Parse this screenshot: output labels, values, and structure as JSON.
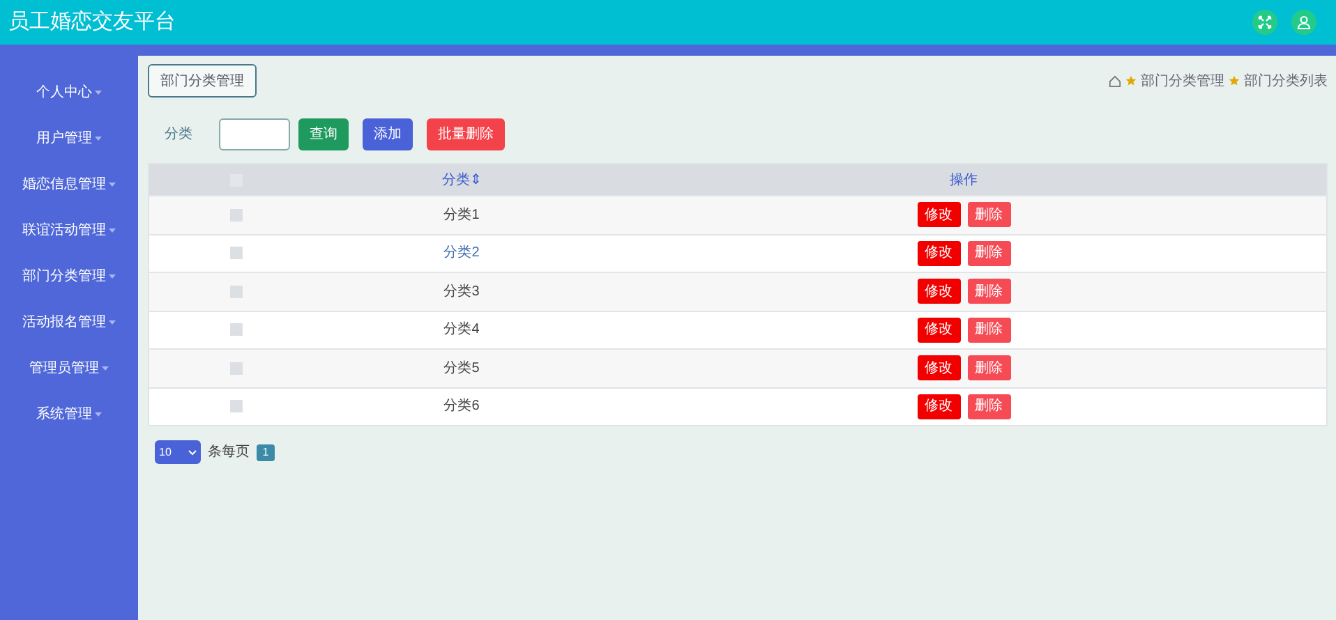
{
  "header": {
    "title": "员工婚恋交友平台"
  },
  "sidebar": {
    "items": [
      {
        "label": "个人中心"
      },
      {
        "label": "用户管理"
      },
      {
        "label": "婚恋信息管理"
      },
      {
        "label": "联谊活动管理"
      },
      {
        "label": "部门分类管理"
      },
      {
        "label": "活动报名管理"
      },
      {
        "label": "管理员管理"
      },
      {
        "label": "系统管理"
      }
    ]
  },
  "page_title": "部门分类管理",
  "breadcrumb": [
    "部门分类管理",
    "部门分类列表"
  ],
  "search": {
    "label": "分类",
    "buttons": [
      {
        "label": "查询",
        "kind": "query"
      },
      {
        "label": "添加",
        "kind": "add"
      },
      {
        "label": "批量删除",
        "kind": "delete"
      }
    ]
  },
  "table": {
    "all_checked": false,
    "columns": [
      "分类⇕",
      "操作"
    ],
    "rows": [
      {
        "category": "分类1",
        "checked": false,
        "hovered": false,
        "actions": [
          "修改",
          "删除"
        ]
      },
      {
        "category": "分类2",
        "checked": false,
        "hovered": true,
        "actions": [
          "修改",
          "删除"
        ]
      },
      {
        "category": "分类3",
        "checked": false,
        "hovered": false,
        "actions": [
          "修改",
          "删除"
        ]
      },
      {
        "category": "分类4",
        "checked": false,
        "hovered": false,
        "actions": [
          "修改",
          "删除"
        ]
      },
      {
        "category": "分类5",
        "checked": false,
        "hovered": false,
        "actions": [
          "修改",
          "删除"
        ]
      },
      {
        "category": "分类6",
        "checked": false,
        "hovered": false,
        "actions": [
          "修改",
          "删除"
        ]
      }
    ]
  },
  "pagination": {
    "page_size": "10",
    "per_page_label": "条每页",
    "pages": [
      {
        "label": "1",
        "selected": true
      }
    ]
  }
}
